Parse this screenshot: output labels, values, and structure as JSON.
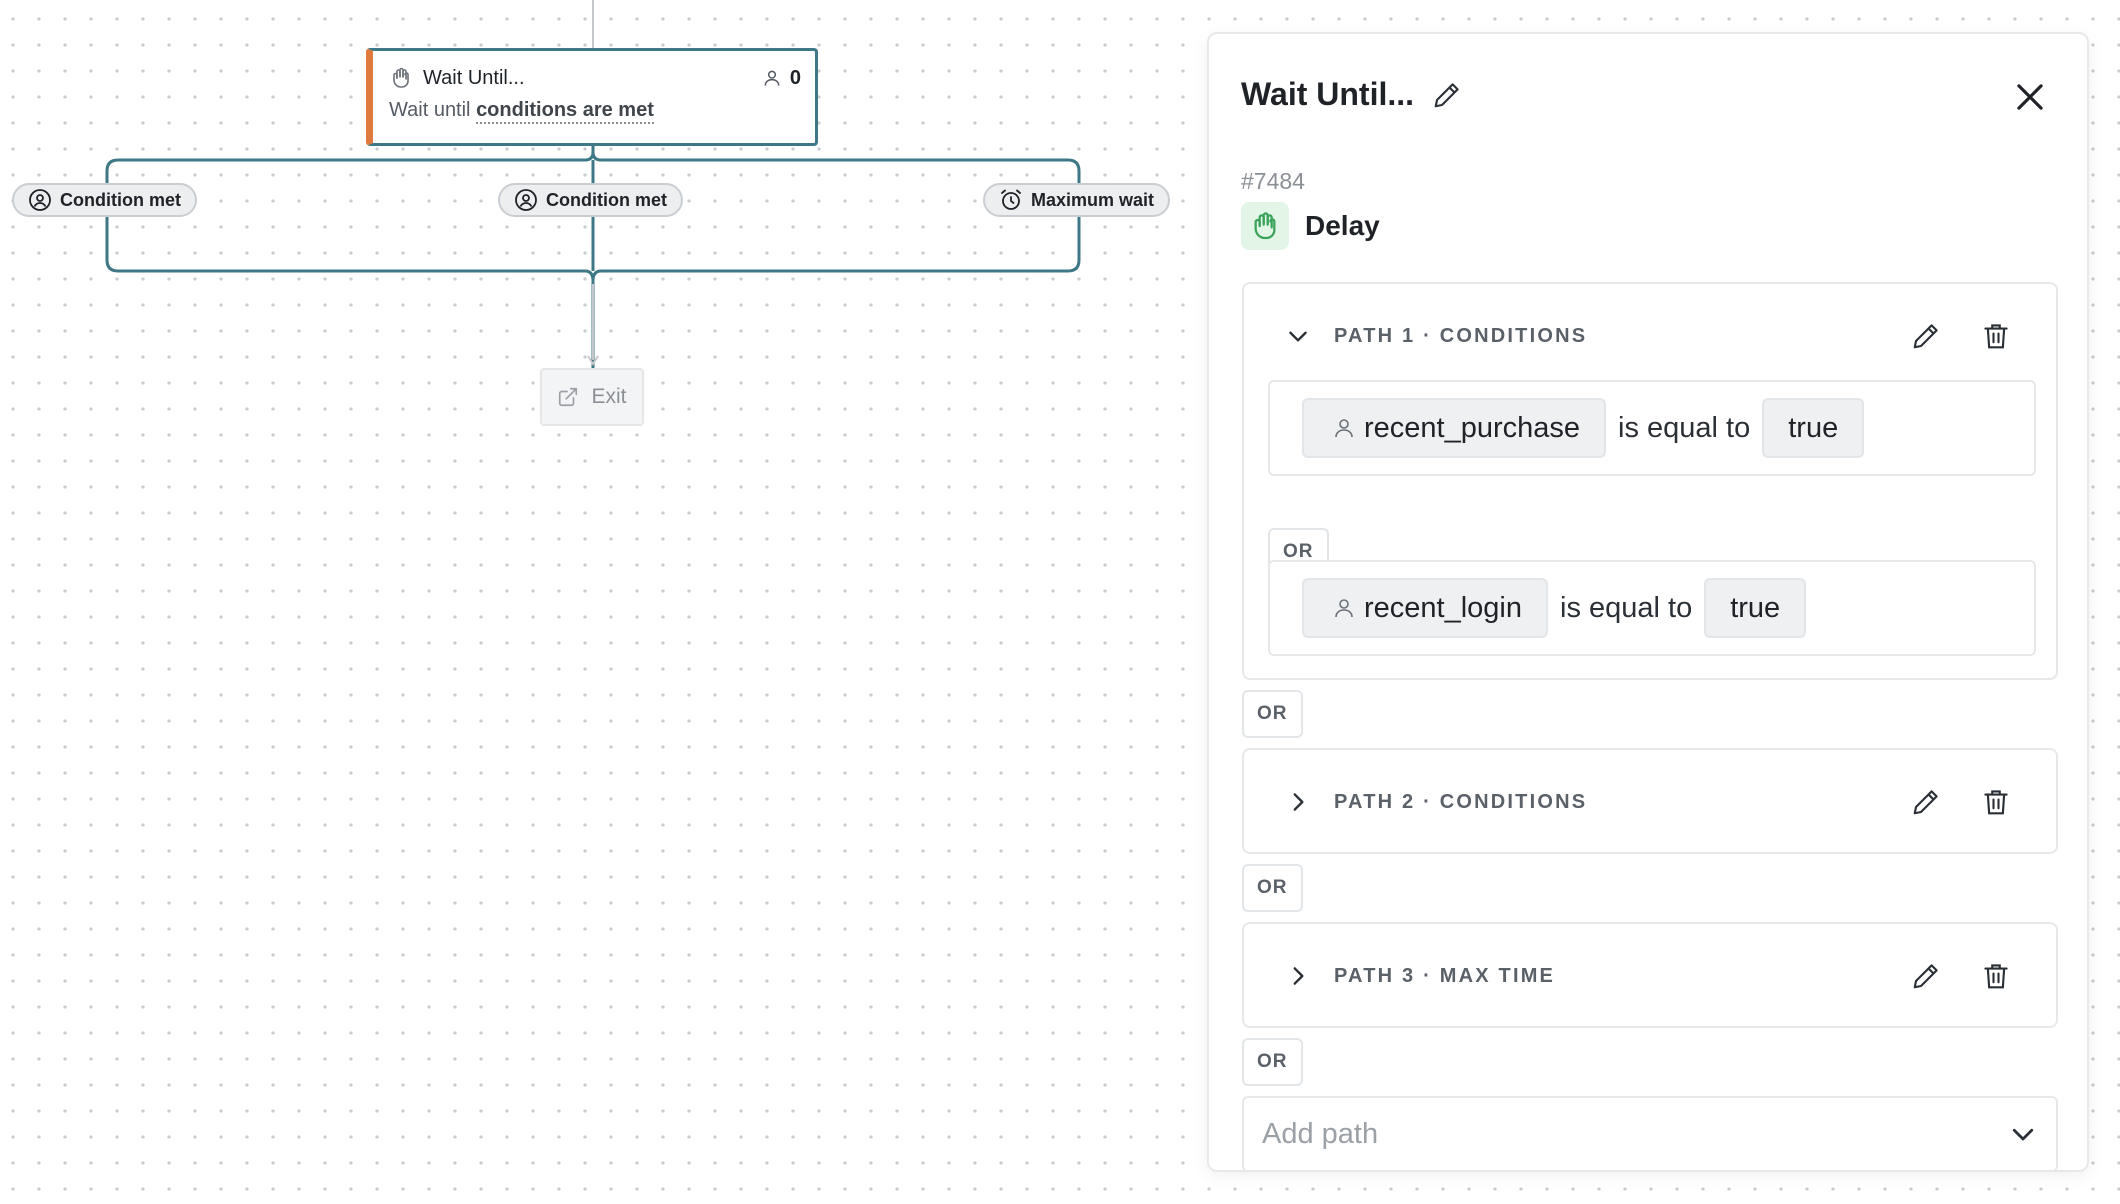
{
  "canvas": {
    "wait_node": {
      "title": "Wait Until...",
      "count": "0",
      "subtitle_prefix": "Wait until ",
      "subtitle_link": "conditions are met"
    },
    "branch_labels": [
      {
        "label": "Condition met",
        "icon": "user-circle-icon"
      },
      {
        "label": "Condition met",
        "icon": "user-circle-icon"
      },
      {
        "label": "Maximum wait",
        "icon": "alarm-clock-icon"
      }
    ],
    "exit_node": {
      "label": "Exit",
      "icon": "external-link-icon"
    }
  },
  "panel": {
    "title": "Wait Until...",
    "node_id": "#7484",
    "type_label": "Delay",
    "type_icon": "hand-icon",
    "paths": [
      {
        "title": "PATH 1 · CONDITIONS",
        "expanded": true,
        "conditions": [
          {
            "attribute": "recent_purchase",
            "operator": "is equal to",
            "value": "true"
          },
          {
            "attribute": "recent_login",
            "operator": "is equal to",
            "value": "true"
          }
        ],
        "inner_or": "OR"
      },
      {
        "title": "PATH 2 · CONDITIONS",
        "expanded": false
      },
      {
        "title": "PATH 3 · MAX TIME",
        "expanded": false
      }
    ],
    "or_label": "OR",
    "add_path_placeholder": "Add path"
  },
  "colors": {
    "node_border": "#3e7785",
    "node_accent": "#e0793d",
    "delay_icon_bg": "#e2f5e6",
    "delay_icon": "#3ca35a"
  }
}
